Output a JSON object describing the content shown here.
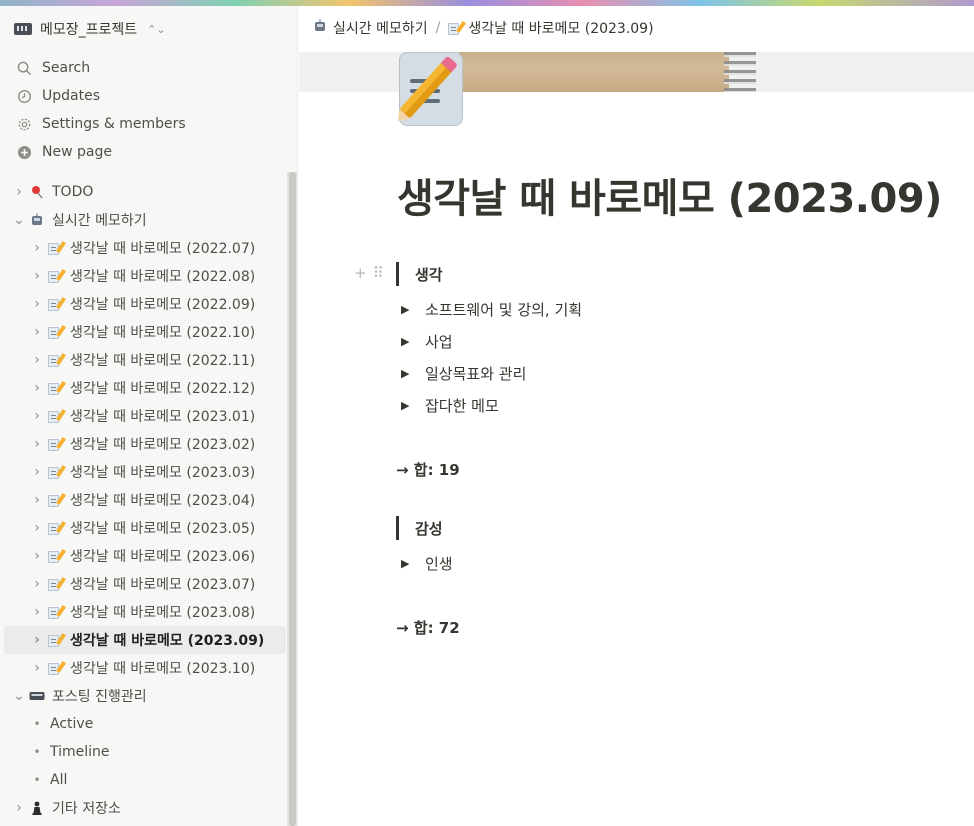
{
  "workspace": {
    "name": "메모장_프로젝트",
    "switcher": "⌃⌄"
  },
  "menu": [
    {
      "label": "Search",
      "icon": "search-icon"
    },
    {
      "label": "Updates",
      "icon": "clock-icon"
    },
    {
      "label": "Settings & members",
      "icon": "gear-icon"
    },
    {
      "label": "New page",
      "icon": "plus-circle-icon"
    }
  ],
  "tree": {
    "todo": "TODO",
    "realtime": "실시간 메모하기",
    "pages": [
      "생각날 때 바로메모 (2022.07)",
      "생각날 때 바로메모 (2022.08)",
      "생각날 때 바로메모 (2022.09)",
      "생각날 때 바로메모 (2022.10)",
      "생각날 때 바로메모 (2022.11)",
      "생각날 때 바로메모 (2022.12)",
      "생각날 때 바로메모 (2023.01)",
      "생각날 때 바로메모 (2023.02)",
      "생각날 때 바로메모 (2023.03)",
      "생각날 때 바로메모 (2023.04)",
      "생각날 때 바로메모 (2023.05)",
      "생각날 때 바로메모 (2023.06)",
      "생각날 때 바로메모 (2023.07)",
      "생각날 때 바로메모 (2023.08)",
      "생각날 때 바로메모 (2023.09)",
      "생각날 때 바로메모 (2023.10)"
    ],
    "active_index": 14,
    "posting": "포스팅 진행관리",
    "posting_views": [
      "Active",
      "Timeline",
      "All"
    ],
    "storage": "기타 저장소"
  },
  "breadcrumb": {
    "parent": "실시간 메모하기",
    "separator": "/",
    "current": "생각날 때 바로메모 (2023.09)"
  },
  "page": {
    "title": "생각날 때 바로메모 (2023.09)",
    "sections": [
      {
        "heading": "생각",
        "toggles": [
          "소프트웨어 및 강의, 기획",
          "사업",
          "일상목표와 관리",
          "잡다한 메모"
        ],
        "total": "→ 합: 19"
      },
      {
        "heading": "감성",
        "toggles": [
          "인생"
        ],
        "total": "→ 합: 72"
      }
    ]
  },
  "colors": {
    "sidebar_bg": "#f7f7f5",
    "text": "#37352f",
    "active_row": "#ebebea"
  }
}
